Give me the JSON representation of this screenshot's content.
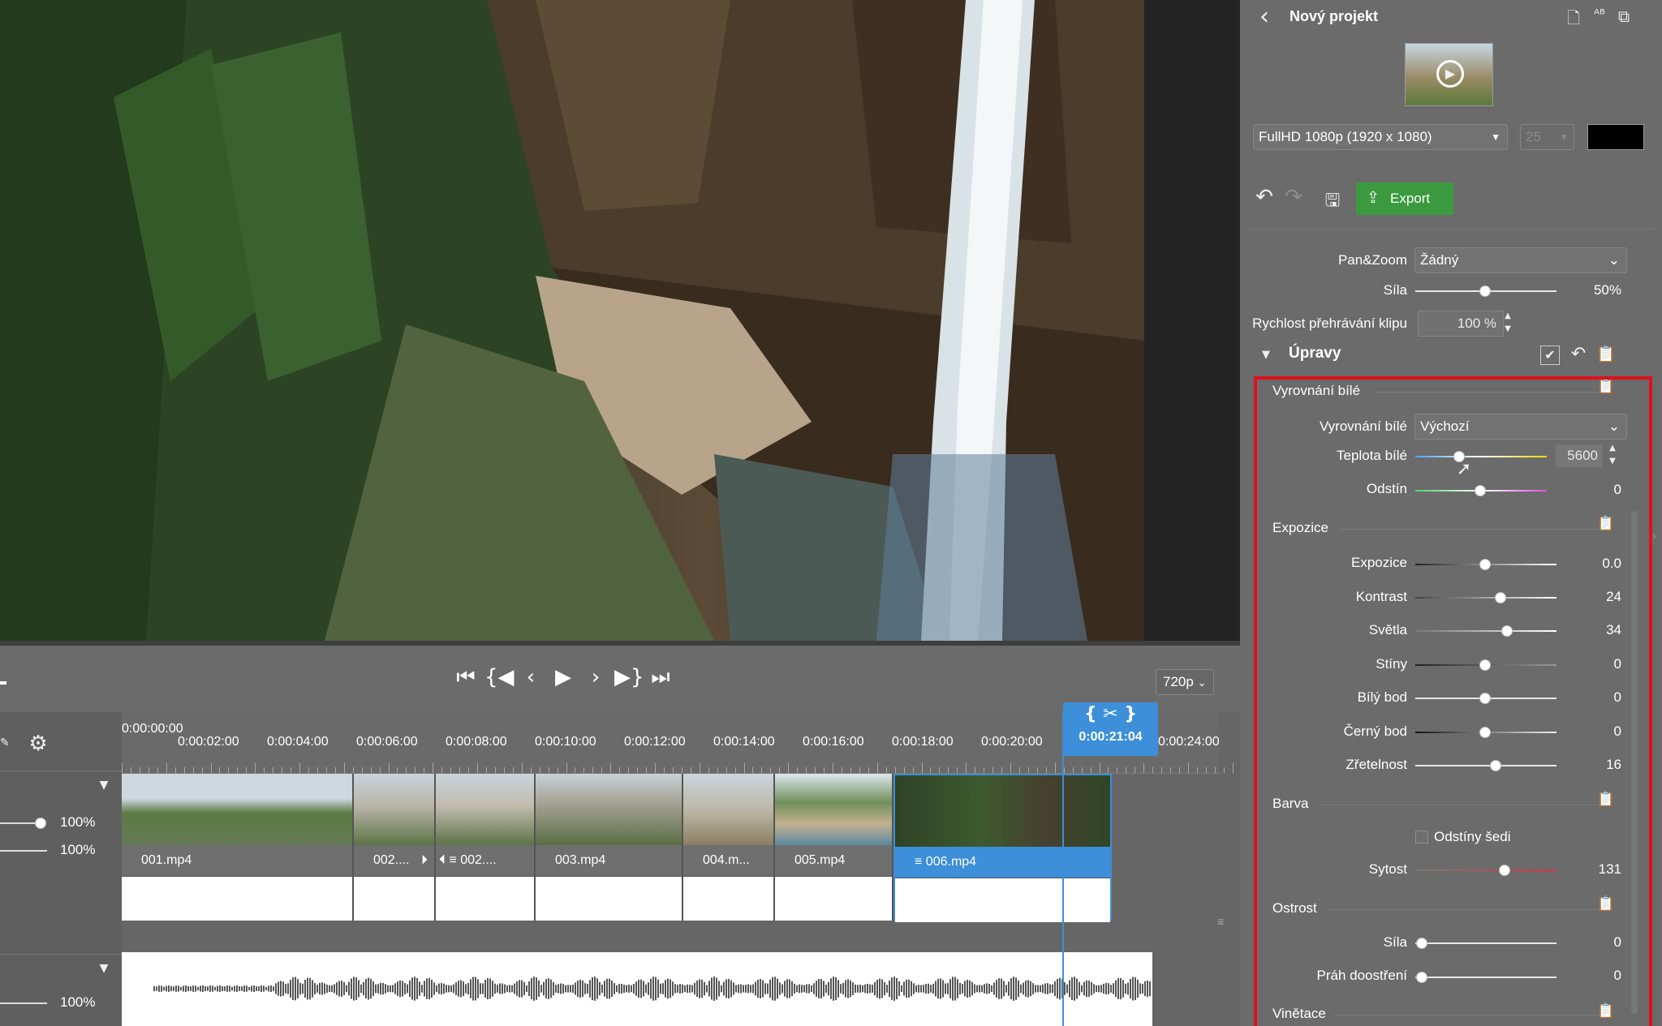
{
  "project": {
    "title": "Nový projekt"
  },
  "toolbar": {
    "format": "FullHD 1080p (1920 x 1080)",
    "fps": "25",
    "export_label": "Export",
    "quality": "720p"
  },
  "transport": {
    "buttons": [
      "skip-to-start",
      "prev-marker",
      "prev-frame",
      "play",
      "next-frame",
      "next-marker",
      "skip-to-end"
    ]
  },
  "timeline": {
    "ruler_labels": [
      "0:00:00:00",
      "0:00:02:00",
      "0:00:04:00",
      "0:00:06:00",
      "0:00:08:00",
      "0:00:10:00",
      "0:00:12:00",
      "0:00:14:00",
      "0:00:16:00",
      "0:00:18:00",
      "0:00:20:00",
      "0:00:24:00"
    ],
    "playhead_time": "0:00:21:04",
    "clips": [
      "001.mp4",
      "002....",
      "002....",
      "003.mp4",
      "004.m...",
      "005.mp4",
      "006.mp4"
    ],
    "video_volume": "100%",
    "video_volume2": "100%",
    "audio_volume": "100%"
  },
  "panel": {
    "pan_zoom_label": "Pan&Zoom",
    "pan_zoom_value": "Žádný",
    "sila_label": "Síla",
    "sila_value": "50%",
    "speed_label": "Rychlost přehrávání klipu",
    "speed_value": "100 %",
    "upravy_title": "Úpravy",
    "wb_section": "Vyrovnání bílé",
    "wb_label": "Vyrovnání bílé",
    "wb_value": "Výchozí",
    "temp_label": "Teplota bílé",
    "temp_value": "5600",
    "tint_label": "Odstín",
    "tint_value": "0",
    "exp_section": "Expozice",
    "exposure": [
      {
        "label": "Expozice",
        "value": "0.0"
      },
      {
        "label": "Kontrast",
        "value": "24"
      },
      {
        "label": "Světla",
        "value": "34"
      },
      {
        "label": "Stíny",
        "value": "0"
      },
      {
        "label": "Bílý bod",
        "value": "0"
      },
      {
        "label": "Černý bod",
        "value": "0"
      },
      {
        "label": "Zřetelnost",
        "value": "16"
      }
    ],
    "color_section": "Barva",
    "grayscale_label": "Odstíny šedi",
    "saturation_label": "Sytost",
    "saturation_value": "131",
    "sharp_section": "Ostrost",
    "sharp_strength_label": "Síla",
    "sharp_strength_value": "0",
    "sharp_threshold_label": "Práh doostření",
    "sharp_threshold_value": "0",
    "vignette_section": "Vinětace"
  },
  "colors": {
    "accent": "#3c8fd8",
    "export_green": "#3b9a3f",
    "highlight": "#e0101c"
  }
}
